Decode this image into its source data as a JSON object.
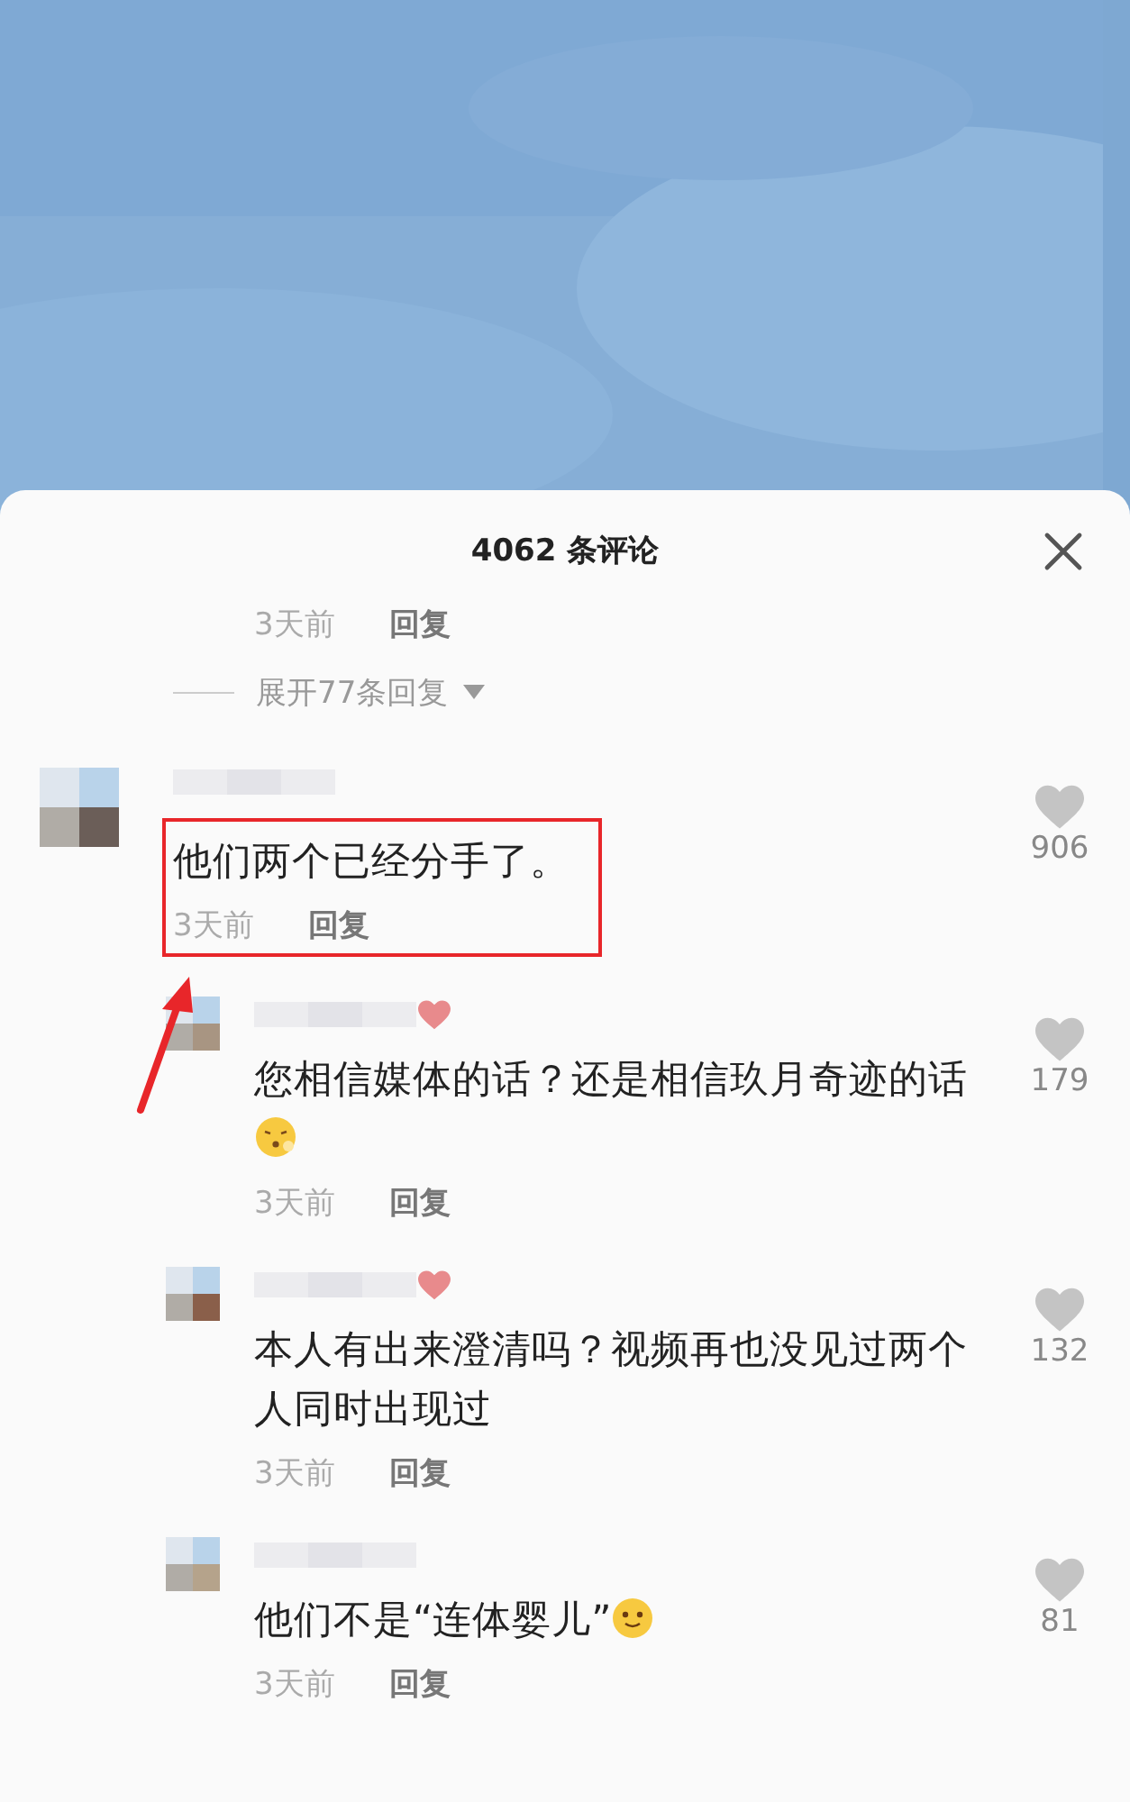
{
  "comments_panel": {
    "title": "4062 条评论",
    "items": [
      {
        "kind": "meta",
        "time": "3天前",
        "reply": "回复"
      },
      {
        "kind": "expand",
        "label": "展开77条回复"
      },
      {
        "kind": "comment",
        "text": "他们两个已经分手了。",
        "time": "3天前",
        "reply": "回复",
        "likes": "906",
        "author_liked": false,
        "highlighted": true,
        "children": [
          {
            "kind": "comment",
            "text": "您相信媒体的话？还是相信玖月奇迹的话",
            "emoji": {
              "kind": "sleepy"
            },
            "time": "3天前",
            "reply": "回复",
            "likes": "179",
            "author_liked": true,
            "highlighted": false
          },
          {
            "kind": "comment",
            "text": "本人有出来澄清吗？视频再也没见过两个人同时出现过",
            "time": "3天前",
            "reply": "回复",
            "likes": "132",
            "author_liked": true,
            "highlighted": false
          },
          {
            "kind": "comment",
            "text": "他们不是“连体婴儿”",
            "emoji": {
              "kind": "smile"
            },
            "time": "3天前",
            "reply": "回复",
            "likes": "81",
            "author_liked": false,
            "highlighted": false
          }
        ]
      }
    ]
  }
}
